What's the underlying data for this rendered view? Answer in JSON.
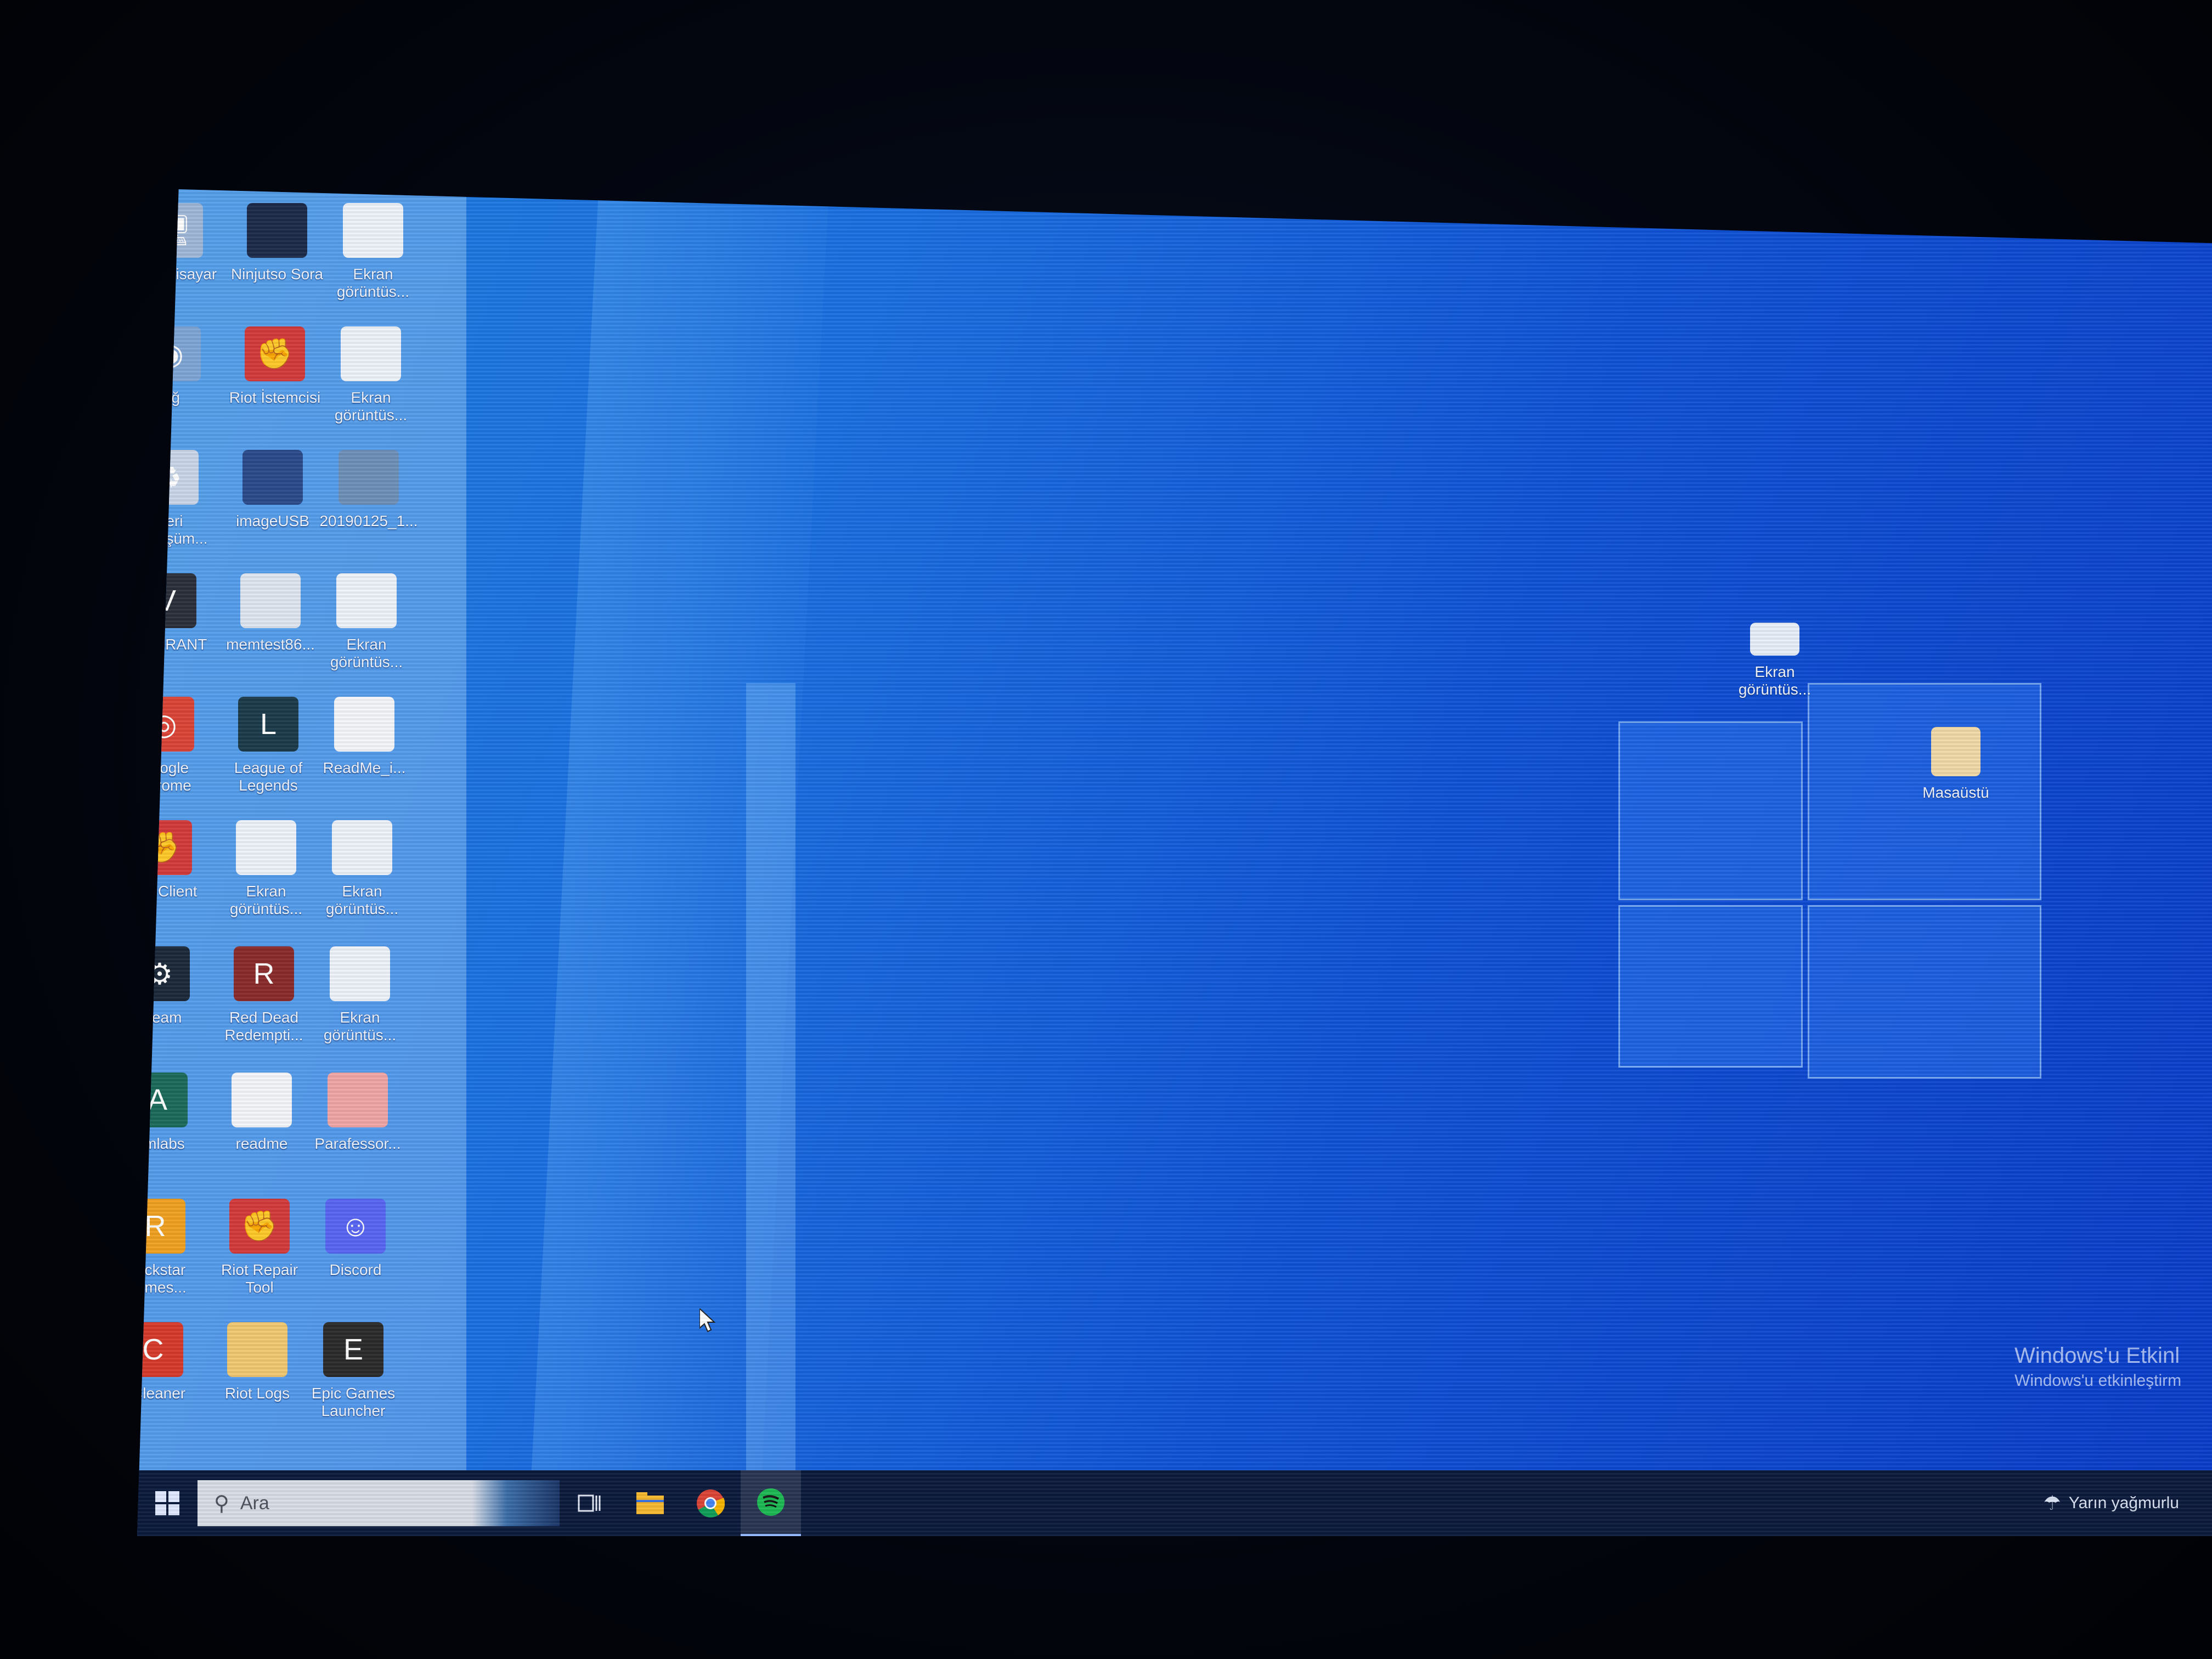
{
  "desktop": {
    "icons": [
      {
        "label": "Bu bilgisayar",
        "icon": "computer-icon"
      },
      {
        "label": "Ninjutso Sora",
        "icon": "mouse-driver-icon"
      },
      {
        "label": "Ekran görüntüs...",
        "icon": "screenshot-file-icon"
      },
      {
        "label": "Ağ",
        "icon": "network-icon"
      },
      {
        "label": "Riot İstemcisi",
        "icon": "riot-client-icon"
      },
      {
        "label": "Ekran görüntüs...",
        "icon": "screenshot-file-icon"
      },
      {
        "label": "Geri Dönüşüm...",
        "icon": "recycle-bin-icon"
      },
      {
        "label": "imageUSB",
        "icon": "imageusb-icon"
      },
      {
        "label": "20190125_1...",
        "icon": "image-file-icon"
      },
      {
        "label": "VALORANT",
        "icon": "valorant-icon"
      },
      {
        "label": "memtest86...",
        "icon": "disk-image-icon"
      },
      {
        "label": "Ekran görüntüs...",
        "icon": "screenshot-file-icon"
      },
      {
        "label": "Google Chrome",
        "icon": "chrome-icon"
      },
      {
        "label": "League of Legends",
        "icon": "league-of-legends-icon"
      },
      {
        "label": "ReadMe_i...",
        "icon": "text-file-icon"
      },
      {
        "label": "Riot Client",
        "icon": "riot-client-icon"
      },
      {
        "label": "Ekran görüntüs...",
        "icon": "screenshot-file-icon"
      },
      {
        "label": "Ekran görüntüs...",
        "icon": "screenshot-file-icon"
      },
      {
        "label": "Steam",
        "icon": "steam-icon"
      },
      {
        "label": "Red Dead Redempti...",
        "icon": "red-dead-redemption-icon"
      },
      {
        "label": "Ekran görüntüs...",
        "icon": "screenshot-file-icon"
      },
      {
        "label": "Aimlabs",
        "icon": "aimlabs-icon"
      },
      {
        "label": "readme",
        "icon": "text-file-icon"
      },
      {
        "label": "Parafessor...",
        "icon": "app-shortcut-icon"
      },
      {
        "label": "Rockstar Games...",
        "icon": "rockstar-games-icon"
      },
      {
        "label": "Riot Repair Tool",
        "icon": "riot-repair-icon"
      },
      {
        "label": "Discord",
        "icon": "discord-icon"
      },
      {
        "label": "CCleaner",
        "icon": "ccleaner-icon"
      },
      {
        "label": "Riot Logs",
        "icon": "folder-icon"
      },
      {
        "label": "Epic Games Launcher",
        "icon": "epic-games-icon"
      }
    ],
    "right_icons": [
      {
        "label": "Ekran görüntüs...",
        "icon": "screenshot-file-icon"
      },
      {
        "label": "Masaüstü",
        "icon": "desktop-folder-icon"
      }
    ]
  },
  "taskbar": {
    "search_placeholder": "Ara",
    "pinned": [
      "task-view-icon",
      "file-explorer-icon",
      "chrome-icon",
      "spotify-icon"
    ],
    "tray_text": "Yarın yağmurlu"
  },
  "watermark": {
    "title": "Windows'u Etkinl",
    "subtitle": "Windows'u etkinleştirm"
  },
  "colors": {
    "desktop_blue": "#1a6fe2",
    "taskbar": "#0c1a3c"
  }
}
